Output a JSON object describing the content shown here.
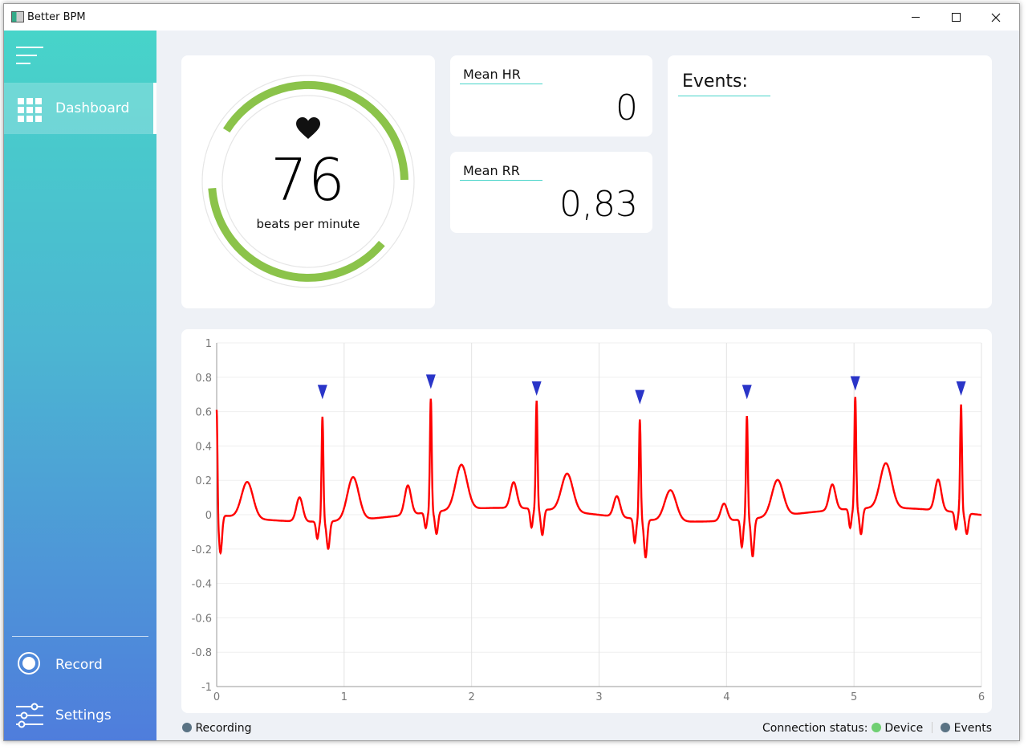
{
  "window": {
    "title": "Better BPM"
  },
  "sidebar": {
    "menu_icon": "hamburger-icon",
    "items": [
      {
        "label": "Dashboard",
        "icon": "grid-icon",
        "active": true
      },
      {
        "label": "Record",
        "icon": "record-icon"
      },
      {
        "label": "Settings",
        "icon": "sliders-icon"
      }
    ]
  },
  "heart_rate": {
    "value": "76",
    "unit": "beats per minute",
    "gauge_fraction": 0.76,
    "icon": "heart-icon",
    "gauge_color": "#8bc34a"
  },
  "stats": {
    "mean_hr": {
      "label": "Mean HR",
      "value": "0"
    },
    "mean_rr": {
      "label": "Mean RR",
      "value": "0,83"
    }
  },
  "events": {
    "title": "Events:"
  },
  "status": {
    "recording_label": "Recording",
    "connection_label": "Connection status:",
    "device_label": "Device",
    "events_label": "Events",
    "recording_color": "#5a7384",
    "device_color": "#6fcf72",
    "events_color": "#5a7384"
  },
  "chart_data": {
    "type": "line",
    "xlim": [
      0,
      6
    ],
    "ylim": [
      -1,
      1
    ],
    "x_ticks": [
      "0",
      "1",
      "2",
      "3",
      "4",
      "5",
      "6"
    ],
    "y_ticks": [
      "1",
      "0.8",
      "0.6",
      "0.4",
      "0.2",
      "0",
      "-0.2",
      "-0.4",
      "-0.6",
      "-0.8",
      "-1"
    ],
    "grid": true,
    "series": [
      {
        "color": "#ff0000",
        "beats": [
          {
            "x": 0.83,
            "r": 0.61,
            "p": 0.14,
            "t": 0.25,
            "s": -0.16,
            "q": -0.1
          },
          {
            "x": 1.68,
            "r": 0.66,
            "p": 0.17,
            "t": 0.26,
            "s": -0.13,
            "q": -0.09
          },
          {
            "x": 2.51,
            "r": 0.63,
            "p": 0.15,
            "t": 0.22,
            "s": -0.15,
            "q": -0.11
          },
          {
            "x": 3.32,
            "r": 0.58,
            "p": 0.12,
            "t": 0.18,
            "s": -0.22,
            "q": -0.14
          },
          {
            "x": 4.16,
            "r": 0.6,
            "p": 0.1,
            "t": 0.21,
            "s": -0.22,
            "q": -0.16
          },
          {
            "x": 5.01,
            "r": 0.65,
            "p": 0.15,
            "t": 0.26,
            "s": -0.15,
            "q": -0.11
          },
          {
            "x": 5.84,
            "r": 0.63,
            "p": 0.18,
            "t": 0.0,
            "s": -0.12,
            "q": -0.1
          }
        ]
      }
    ],
    "markers": {
      "color": "#2a35c8",
      "points": [
        {
          "x": 0.83,
          "y": 0.7
        },
        {
          "x": 1.68,
          "y": 0.76
        },
        {
          "x": 2.51,
          "y": 0.72
        },
        {
          "x": 3.32,
          "y": 0.67
        },
        {
          "x": 4.16,
          "y": 0.7
        },
        {
          "x": 5.01,
          "y": 0.75
        },
        {
          "x": 5.84,
          "y": 0.72
        }
      ]
    }
  }
}
